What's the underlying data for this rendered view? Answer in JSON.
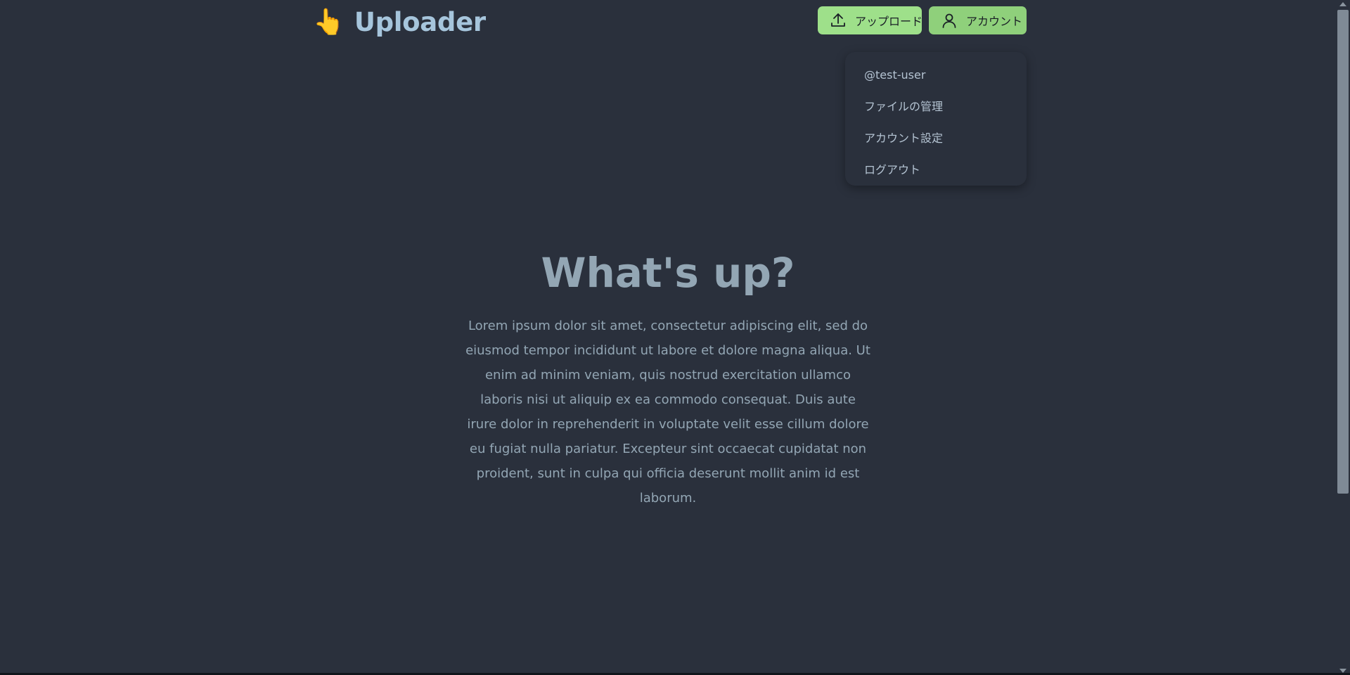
{
  "header": {
    "brand_emoji": "👆",
    "brand_title": "Uploader",
    "upload_label": "アップロード",
    "account_label": "アカウント"
  },
  "dropdown": {
    "items": [
      {
        "label": "@test-user"
      },
      {
        "label": "ファイルの管理"
      },
      {
        "label": "アカウント設定"
      },
      {
        "label": "ログアウト"
      }
    ]
  },
  "hero": {
    "title": "What's up?",
    "body": "Lorem ipsum dolor sit amet, consectetur adipiscing elit, sed do eiusmod tempor incididunt ut labore et dolore magna aliqua. Ut enim ad minim veniam, quis nostrud exercitation ullamco laboris nisi ut aliquip ex ea commodo consequat. Duis aute irure dolor in reprehenderit in voluptate velit esse cillum dolore eu fugiat nulla pariatur. Excepteur sint occaecat cupidatat non proident, sunt in culpa qui officia deserunt mollit anim id est laborum."
  },
  "colors": {
    "background": "#2a303c",
    "button_green": "#9ee08a",
    "brand_text": "#a6c5dc",
    "muted_text": "#93a6b4"
  },
  "icons": {
    "upload": "upload-icon",
    "account": "user-icon"
  }
}
